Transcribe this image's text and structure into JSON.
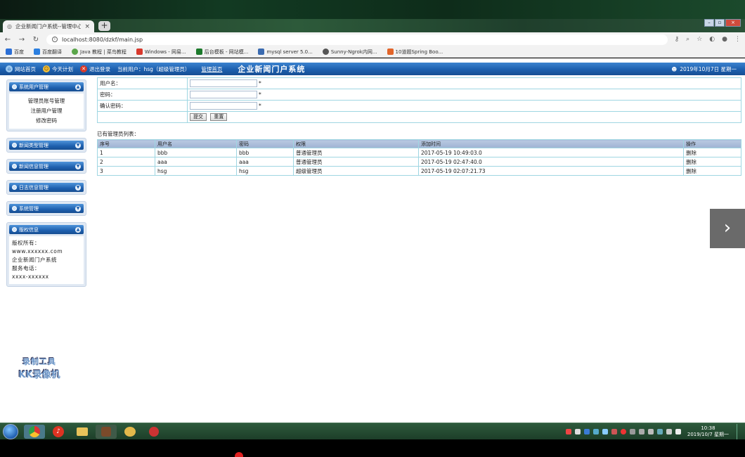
{
  "browser": {
    "tab_title": "企业新闻门户系统--管理中心",
    "url": "localhost:8080/dzkf/main.jsp",
    "bookmarks": [
      "百度",
      "百度翻译",
      "Java 教程 | 菜鸟教程",
      "Windows - 网易...",
      "后台模板 - 网站模...",
      "mysql server 5.0...",
      "Sunny-Ngrok内网...",
      "10道题Spring Boo..."
    ]
  },
  "header": {
    "home": "网站首页",
    "today": "今天计划",
    "logout": "退出登录",
    "current_user": "当前用户：hsg（超级管理员）",
    "help": "管理首页",
    "system_title": "企业新闻门户系统",
    "date": "2019年10月7日 星期一"
  },
  "sidebar": {
    "boxes": [
      {
        "title": "系统用户管理",
        "items": [
          "管理员账号管理",
          "注册用户管理",
          "修改密码"
        ]
      },
      {
        "title": "新闻类型管理",
        "items": []
      },
      {
        "title": "新闻信息管理",
        "items": []
      },
      {
        "title": "日志信息管理",
        "items": []
      },
      {
        "title": "系统管理",
        "items": []
      },
      {
        "title": "版权信息",
        "items": []
      }
    ],
    "copyright": [
      "版权所有：",
      "www.xxxxxx.com",
      "企业新闻门户系统",
      "服务电话：",
      "xxxx-xxxxxx"
    ]
  },
  "watermark": {
    "line1": "录制工具",
    "line2": "KK录像机"
  },
  "form": {
    "username_label": "用户名：",
    "password_label": "密码：",
    "confirm_label": "确认密码：",
    "username_value": "",
    "password_value": "",
    "confirm_value": "",
    "required_mark": "*",
    "submit_label": "提交",
    "reset_label": "重置"
  },
  "list": {
    "title": "已有管理员列表：",
    "columns": [
      "序号",
      "用户名",
      "密码",
      "权限",
      "添加时间",
      "操作"
    ],
    "rows": [
      [
        "1",
        "bbb",
        "bbb",
        "普通管理员",
        "2017-05-19 10:49:03.0",
        "删除"
      ],
      [
        "2",
        "aaa",
        "aaa",
        "普通管理员",
        "2017-05-19 02:47:40.0",
        "删除"
      ],
      [
        "3",
        "hsg",
        "hsg",
        "超级管理员",
        "2017-05-19 02:07:21.73",
        "删除"
      ]
    ]
  },
  "taskbar": {
    "time": "10:38",
    "date": "2019/10/7 星期一"
  }
}
